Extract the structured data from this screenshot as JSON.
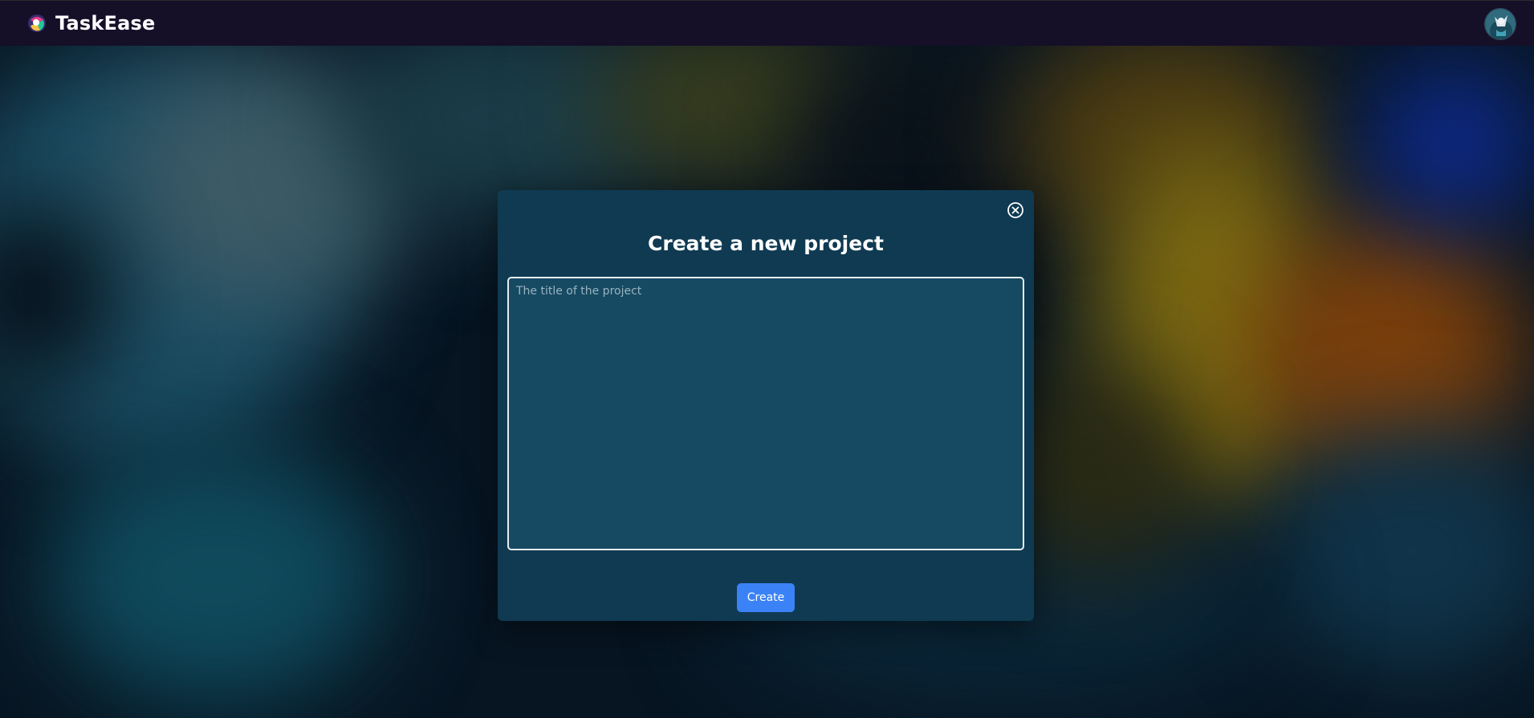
{
  "app": {
    "name": "TaskEase"
  },
  "header": {
    "logo_icon": "taskease-logo-icon",
    "avatar_icon": "user-avatar-icon"
  },
  "modal": {
    "title": "Create a new project",
    "close_icon": "close-circle-icon",
    "input": {
      "placeholder": "The title of the project",
      "value": ""
    },
    "create_label": "Create"
  },
  "colors": {
    "topbar": "#150f28",
    "modal_bg": "#0f3a52",
    "input_bg": "#164a62",
    "primary_button": "#3b82f6"
  }
}
